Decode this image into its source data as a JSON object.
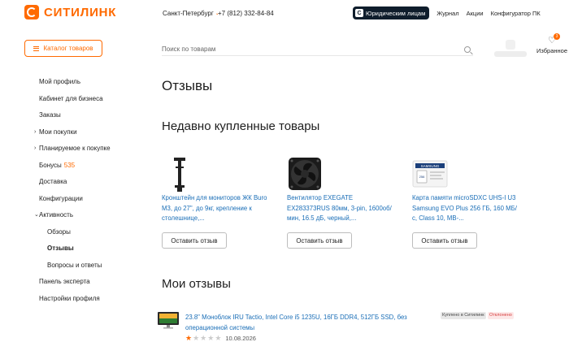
{
  "header": {
    "brand": "СИТИЛИНК",
    "city": "Санкт-Петербург",
    "phone": "+7 (812) 332-84-84",
    "legal_label": "Юридическим лицам",
    "legal_icon_letter": "C",
    "links": [
      "Журнал",
      "Акции",
      "Конфигуратор ПК"
    ],
    "catalog_label": "Каталог товаров",
    "search_placeholder": "Поиск по товарам",
    "favorites_label": "Избранное",
    "favorites_count": "3"
  },
  "sidebar": {
    "items": [
      {
        "label": "Мой профиль",
        "arrow": ""
      },
      {
        "label": "Кабинет для бизнеса",
        "arrow": ""
      },
      {
        "label": "Заказы",
        "arrow": ""
      },
      {
        "label": "Мои покупки",
        "arrow": "›"
      },
      {
        "label": "Планируемое к покупке",
        "arrow": "›"
      },
      {
        "label": "Бонусы",
        "arrow": "",
        "count": "535"
      },
      {
        "label": "Доставка",
        "arrow": ""
      },
      {
        "label": "Конфигурации",
        "arrow": ""
      },
      {
        "label": "Активность",
        "arrow": "⌄"
      },
      {
        "label": "Обзоры",
        "arrow": "",
        "sub": true
      },
      {
        "label": "Отзывы",
        "arrow": "",
        "sub": true,
        "active": true
      },
      {
        "label": "Вопросы и ответы",
        "arrow": "",
        "sub": true
      },
      {
        "label": "Панель эксперта",
        "arrow": ""
      },
      {
        "label": "Настройки профиля",
        "arrow": ""
      }
    ]
  },
  "main": {
    "title": "Отзывы",
    "recent_heading": "Недавно купленные товары",
    "products": [
      {
        "title": "Кронштейн для мониторов ЖК Buro M3, до 27\", до 9кг, крепление к столешнице,...",
        "button": "Оставить отзыв",
        "icon": "monitor-mount-icon"
      },
      {
        "title": "Вентилятор EXEGATE EX283373RUS 80мм, 3-pin, 1600об/мин, 16.5 дБ, черный,...",
        "button": "Оставить отзыв",
        "icon": "case-fan-icon"
      },
      {
        "title": "Карта памяти microSDXC UHS-I U3 Samsung EVO Plus 256 ГБ, 160 МБ/с, Class 10, MB-...",
        "button": "Оставить отзыв",
        "icon": "memory-card-icon",
        "card_brand": "SAMSUNG",
        "card_size": "256"
      }
    ],
    "my_reviews_heading": "Мои отзывы",
    "review": {
      "title": "23.8\" Моноблок IRU Tactio, Intel Core i5 1235U, 16ГБ DDR4, 512ГБ SSD, без операционной системы",
      "rating": 1,
      "date": "10.08.2026",
      "tag_bought": "Куплено в Ситилинк",
      "tag_status": "Отклонено"
    }
  },
  "colors": {
    "accent": "#ff6a00",
    "link": "#1a6eb7",
    "dark": "#0f1d2c"
  }
}
